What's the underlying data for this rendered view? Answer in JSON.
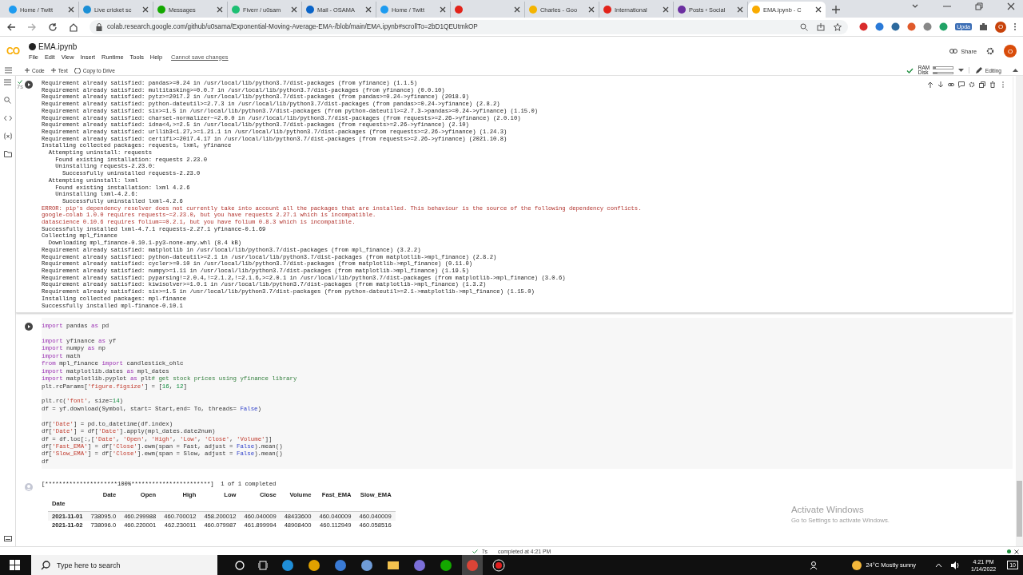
{
  "browser": {
    "tabs": [
      {
        "title": "Home / Twitt",
        "selected": false
      },
      {
        "title": "Live cricket sc",
        "selected": false
      },
      {
        "title": "Messages",
        "selected": false
      },
      {
        "title": "Fiverr / u0sam",
        "selected": false
      },
      {
        "title": "Mail - OSAMA",
        "selected": false
      },
      {
        "title": "Home / Twitt",
        "selected": false
      },
      {
        "selected": false
      },
      {
        "title": "Charles - Goo",
        "selected": false
      },
      {
        "title": "International",
        "selected": false
      },
      {
        "title": "Posts ‹ Social",
        "selected": false
      },
      {
        "title": "EMA.ipynb - C",
        "selected": true
      }
    ],
    "url": "colab.research.google.com/github/u0sama/Exponential-Moving-Average-EMA-/blob/main/EMA.ipynb#scrollTo=2bD1QEUtmkOP",
    "update_badge": "Upda",
    "profile": "O"
  },
  "colab": {
    "logo": "CO",
    "file_name": "EMA.ipynb",
    "menu": [
      "File",
      "Edit",
      "View",
      "Insert",
      "Runtime",
      "Tools",
      "Help"
    ],
    "save_notice": "Cannot save changes",
    "share": "Share",
    "profile": "O",
    "toolbar": [
      "Code",
      "Text"
    ],
    "copy_to_drive": "Copy to Drive",
    "resources": [
      {
        "label": "RAM",
        "level": 0.12
      },
      {
        "label": "Disk",
        "level": 0.22
      }
    ],
    "mode": "Editing"
  },
  "cells": [
    {
      "kind": "output",
      "exec_time": "7s",
      "lines": [
        {
          "kind": "normal",
          "text": "Requirement already satisfied: pandas>=0.24 in /usr/local/lib/python3.7/dist-packages (from yfinance) (1.1.5)"
        },
        {
          "kind": "normal",
          "text": "Requirement already satisfied: multitasking>=0.0.7 in /usr/local/lib/python3.7/dist-packages (from yfinance) (0.0.10)"
        },
        {
          "kind": "normal",
          "text": "Requirement already satisfied: pytz>=2017.2 in /usr/local/lib/python3.7/dist-packages (from pandas>=0.24->yfinance) (2018.9)"
        },
        {
          "kind": "normal",
          "text": "Requirement already satisfied: python-dateutil>=2.7.3 in /usr/local/lib/python3.7/dist-packages (from pandas>=0.24->yfinance) (2.8.2)"
        },
        {
          "kind": "normal",
          "text": "Requirement already satisfied: six>=1.5 in /usr/local/lib/python3.7/dist-packages (from python-dateutil>=2.7.3->pandas>=0.24->yfinance) (1.15.0)"
        },
        {
          "kind": "normal",
          "text": "Requirement already satisfied: charset-normalizer~=2.0.0 in /usr/local/lib/python3.7/dist-packages (from requests>=2.26->yfinance) (2.0.10)"
        },
        {
          "kind": "normal",
          "text": "Requirement already satisfied: idna<4,>=2.5 in /usr/local/lib/python3.7/dist-packages (from requests>=2.26->yfinance) (2.10)"
        },
        {
          "kind": "normal",
          "text": "Requirement already satisfied: urllib3<1.27,>=1.21.1 in /usr/local/lib/python3.7/dist-packages (from requests>=2.26->yfinance) (1.24.3)"
        },
        {
          "kind": "normal",
          "text": "Requirement already satisfied: certifi>=2017.4.17 in /usr/local/lib/python3.7/dist-packages (from requests>=2.26->yfinance) (2021.10.8)"
        },
        {
          "kind": "normal",
          "text": "Installing collected packages: requests, lxml, yfinance"
        },
        {
          "kind": "normal",
          "text": "  Attempting uninstall: requests"
        },
        {
          "kind": "normal",
          "text": "    Found existing installation: requests 2.23.0"
        },
        {
          "kind": "normal",
          "text": "    Uninstalling requests-2.23.0:"
        },
        {
          "kind": "normal",
          "text": "      Successfully uninstalled requests-2.23.0"
        },
        {
          "kind": "normal",
          "text": "  Attempting uninstall: lxml"
        },
        {
          "kind": "normal",
          "text": "    Found existing installation: lxml 4.2.6"
        },
        {
          "kind": "normal",
          "text": "    Uninstalling lxml-4.2.6:"
        },
        {
          "kind": "normal",
          "text": "      Successfully uninstalled lxml-4.2.6"
        },
        {
          "kind": "error",
          "text": "ERROR: pip's dependency resolver does not currently take into account all the packages that are installed. This behaviour is the source of the following dependency conflicts."
        },
        {
          "kind": "error",
          "text": "google-colab 1.0.0 requires requests~=2.23.0, but you have requests 2.27.1 which is incompatible."
        },
        {
          "kind": "error",
          "text": "datascience 0.10.6 requires folium==0.2.1, but you have folium 0.8.3 which is incompatible."
        },
        {
          "kind": "normal",
          "text": "Successfully installed lxml-4.7.1 requests-2.27.1 yfinance-0.1.69"
        },
        {
          "kind": "normal",
          "text": "Collecting mpl_finance"
        },
        {
          "kind": "normal",
          "text": "  Downloading mpl_finance-0.10.1-py3-none-any.whl (8.4 kB)"
        },
        {
          "kind": "normal",
          "text": "Requirement already satisfied: matplotlib in /usr/local/lib/python3.7/dist-packages (from mpl_finance) (3.2.2)"
        },
        {
          "kind": "normal",
          "text": "Requirement already satisfied: python-dateutil>=2.1 in /usr/local/lib/python3.7/dist-packages (from matplotlib->mpl_finance) (2.8.2)"
        },
        {
          "kind": "normal",
          "text": "Requirement already satisfied: cycler>=0.10 in /usr/local/lib/python3.7/dist-packages (from matplotlib->mpl_finance) (0.11.0)"
        },
        {
          "kind": "normal",
          "text": "Requirement already satisfied: numpy>=1.11 in /usr/local/lib/python3.7/dist-packages (from matplotlib->mpl_finance) (1.19.5)"
        },
        {
          "kind": "normal",
          "text": "Requirement already satisfied: pyparsing!=2.0.4,!=2.1.2,!=2.1.6,>=2.0.1 in /usr/local/lib/python3.7/dist-packages (from matplotlib->mpl_finance) (3.0.6)"
        },
        {
          "kind": "normal",
          "text": "Requirement already satisfied: kiwisolver>=1.0.1 in /usr/local/lib/python3.7/dist-packages (from matplotlib->mpl_finance) (1.3.2)"
        },
        {
          "kind": "normal",
          "text": "Requirement already satisfied: six>=1.5 in /usr/local/lib/python3.7/dist-packages (from python-dateutil>=2.1->matplotlib->mpl_finance) (1.15.0)"
        },
        {
          "kind": "normal",
          "text": "Installing collected packages: mpl-finance"
        },
        {
          "kind": "normal",
          "text": "Successfully installed mpl-finance-0.10.1"
        }
      ]
    },
    {
      "kind": "code",
      "blocks": [
        [
          [
            {
              "kind": "keyword",
              "text": "import"
            },
            {
              "kind": "name",
              "text": " pandas "
            },
            {
              "kind": "keyword",
              "text": "as"
            },
            {
              "kind": "name",
              "text": " pd"
            }
          ]
        ],
        [
          [
            {
              "kind": "keyword",
              "text": "import"
            },
            {
              "kind": "name",
              "text": " yfinance "
            },
            {
              "kind": "keyword",
              "text": "as"
            },
            {
              "kind": "name",
              "text": " yf"
            }
          ],
          [
            {
              "kind": "keyword",
              "text": "import"
            },
            {
              "kind": "name",
              "text": " numpy "
            },
            {
              "kind": "keyword",
              "text": "as"
            },
            {
              "kind": "name",
              "text": " np"
            }
          ],
          [
            {
              "kind": "keyword",
              "text": "import"
            },
            {
              "kind": "name",
              "text": " math"
            }
          ],
          [
            {
              "kind": "keyword",
              "text": "from"
            },
            {
              "kind": "name",
              "text": " mpl_finance "
            },
            {
              "kind": "keyword",
              "text": "import"
            },
            {
              "kind": "name",
              "text": " candlestick_ohlc"
            }
          ],
          [
            {
              "kind": "keyword",
              "text": "import"
            },
            {
              "kind": "name",
              "text": " matplotlib.dates "
            },
            {
              "kind": "keyword",
              "text": "as"
            },
            {
              "kind": "name",
              "text": " mpl_dates"
            }
          ],
          [
            {
              "kind": "keyword",
              "text": "import"
            },
            {
              "kind": "name",
              "text": " matplotlib.pyplot "
            },
            {
              "kind": "keyword",
              "text": "as"
            },
            {
              "kind": "name",
              "text": " plt"
            },
            {
              "kind": "comment",
              "text": "# get stock prices using yfinance library"
            }
          ],
          [
            {
              "kind": "name",
              "text": "plt.rcParams["
            },
            {
              "kind": "string",
              "text": "'figure.figsize'"
            },
            {
              "kind": "name",
              "text": "] = ["
            },
            {
              "kind": "number",
              "text": "16"
            },
            {
              "kind": "name",
              "text": ", "
            },
            {
              "kind": "number",
              "text": "12"
            },
            {
              "kind": "name",
              "text": "]"
            }
          ]
        ],
        [
          [
            {
              "kind": "name",
              "text": "plt.rc("
            },
            {
              "kind": "string",
              "text": "'font'"
            },
            {
              "kind": "name",
              "text": ", size="
            },
            {
              "kind": "number",
              "text": "14"
            },
            {
              "kind": "name",
              "text": ")"
            }
          ],
          [
            {
              "kind": "name",
              "text": "df = yf.download(Symbol, start= Start,end= To, threads= "
            },
            {
              "kind": "constant",
              "text": "False"
            },
            {
              "kind": "name",
              "text": ")"
            }
          ]
        ],
        [
          [
            {
              "kind": "name",
              "text": "df["
            },
            {
              "kind": "string",
              "text": "'Date'"
            },
            {
              "kind": "name",
              "text": "] = pd.to_datetime(df.index)"
            }
          ],
          [
            {
              "kind": "name",
              "text": "df["
            },
            {
              "kind": "string",
              "text": "'Date'"
            },
            {
              "kind": "name",
              "text": "] = df["
            },
            {
              "kind": "string",
              "text": "'Date'"
            },
            {
              "kind": "name",
              "text": "].apply(mpl_dates.date2num)"
            }
          ],
          [
            {
              "kind": "name",
              "text": "df = df.loc[:,["
            },
            {
              "kind": "string",
              "text": "'Date'"
            },
            {
              "kind": "name",
              "text": ", "
            },
            {
              "kind": "string",
              "text": "'Open'"
            },
            {
              "kind": "name",
              "text": ", "
            },
            {
              "kind": "string",
              "text": "'High'"
            },
            {
              "kind": "name",
              "text": ", "
            },
            {
              "kind": "string",
              "text": "'Low'"
            },
            {
              "kind": "name",
              "text": ", "
            },
            {
              "kind": "string",
              "text": "'Close'"
            },
            {
              "kind": "name",
              "text": ", "
            },
            {
              "kind": "string",
              "text": "'Volume'"
            },
            {
              "kind": "name",
              "text": "]]"
            }
          ],
          [
            {
              "kind": "name",
              "text": "df["
            },
            {
              "kind": "string",
              "text": "'Fast_EMA'"
            },
            {
              "kind": "name",
              "text": "] = df["
            },
            {
              "kind": "string",
              "text": "'Close'"
            },
            {
              "kind": "name",
              "text": "].ewm(span = Fast, adjust = "
            },
            {
              "kind": "constant",
              "text": "False"
            },
            {
              "kind": "name",
              "text": ").mean()"
            }
          ],
          [
            {
              "kind": "name",
              "text": "df["
            },
            {
              "kind": "string",
              "text": "'Slow_EMA'"
            },
            {
              "kind": "name",
              "text": "] = df["
            },
            {
              "kind": "string",
              "text": "'Close'"
            },
            {
              "kind": "name",
              "text": "].ewm(span = Slow, adjust = "
            },
            {
              "kind": "constant",
              "text": "False"
            },
            {
              "kind": "name",
              "text": ").mean()"
            }
          ],
          [
            {
              "kind": "name",
              "text": "df"
            }
          ]
        ]
      ]
    },
    {
      "kind": "table_output",
      "progress": "[*********************100%***********************]  1 of 1 completed",
      "columns": [
        "Date",
        "Open",
        "High",
        "Low",
        "Close",
        "Volume",
        "Fast_EMA",
        "Slow_EMA"
      ],
      "index_name": "Date",
      "rows": [
        {
          "index": "2021-11-01",
          "values": [
            "738095.0",
            "460.299988",
            "460.700012",
            "458.200012",
            "460.040009",
            "48433600",
            "460.040009",
            "460.040009"
          ]
        },
        {
          "index": "2021-11-02",
          "values": [
            "738096.0",
            "460.220001",
            "462.230011",
            "460.079987",
            "461.899994",
            "48908400",
            "460.112949",
            "460.058516"
          ]
        }
      ]
    }
  ],
  "status": {
    "time": "7s",
    "message": "completed at 4:21 PM"
  },
  "activation": {
    "title": "Activate Windows",
    "hint": "Go to Settings to activate Windows."
  },
  "taskbar": {
    "search_placeholder": "Type here to search",
    "weather": "24°C  Mostly sunny",
    "time": "4:21 PM",
    "date": "1/14/2022",
    "notifications": "10"
  }
}
